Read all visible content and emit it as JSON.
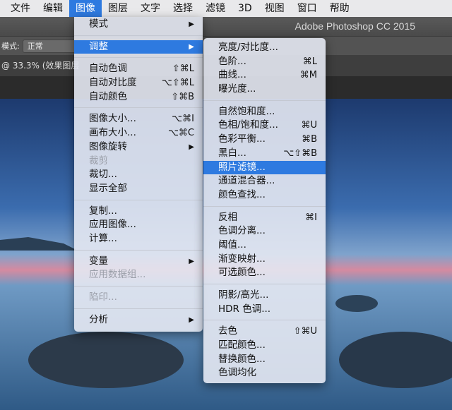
{
  "menubar": [
    "文件",
    "编辑",
    "图像",
    "图层",
    "文字",
    "选择",
    "滤镜",
    "3D",
    "视图",
    "窗口",
    "帮助"
  ],
  "active_menu_index": 2,
  "title": "Adobe Photoshop CC 2015",
  "options": {
    "mode_label": "模式:",
    "mode_value": "正常"
  },
  "doc_tab": "@ 33.3% (效果图层",
  "main_menu": [
    {
      "label": "模式",
      "submenu": true
    },
    {
      "sep": true
    },
    {
      "label": "调整",
      "submenu": true,
      "highlighted": true
    },
    {
      "sep": true
    },
    {
      "label": "自动色调",
      "shortcut": "⇧⌘L"
    },
    {
      "label": "自动对比度",
      "shortcut": "⌥⇧⌘L"
    },
    {
      "label": "自动颜色",
      "shortcut": "⇧⌘B"
    },
    {
      "sep": true
    },
    {
      "label": "图像大小...",
      "shortcut": "⌥⌘I"
    },
    {
      "label": "画布大小...",
      "shortcut": "⌥⌘C"
    },
    {
      "label": "图像旋转",
      "submenu": true
    },
    {
      "label": "裁剪",
      "disabled": true
    },
    {
      "label": "裁切..."
    },
    {
      "label": "显示全部"
    },
    {
      "sep": true
    },
    {
      "label": "复制..."
    },
    {
      "label": "应用图像..."
    },
    {
      "label": "计算..."
    },
    {
      "sep": true
    },
    {
      "label": "变量",
      "submenu": true
    },
    {
      "label": "应用数据组...",
      "disabled": true
    },
    {
      "sep": true
    },
    {
      "label": "陷印...",
      "disabled": true
    },
    {
      "sep": true
    },
    {
      "label": "分析",
      "submenu": true
    }
  ],
  "sub_menu": [
    {
      "label": "亮度/对比度..."
    },
    {
      "label": "色阶...",
      "shortcut": "⌘L"
    },
    {
      "label": "曲线...",
      "shortcut": "⌘M"
    },
    {
      "label": "曝光度..."
    },
    {
      "sep": true
    },
    {
      "label": "自然饱和度..."
    },
    {
      "label": "色相/饱和度...",
      "shortcut": "⌘U"
    },
    {
      "label": "色彩平衡...",
      "shortcut": "⌘B"
    },
    {
      "label": "黑白...",
      "shortcut": "⌥⇧⌘B"
    },
    {
      "label": "照片滤镜...",
      "highlighted": true
    },
    {
      "label": "通道混合器..."
    },
    {
      "label": "颜色查找..."
    },
    {
      "sep": true
    },
    {
      "label": "反相",
      "shortcut": "⌘I"
    },
    {
      "label": "色调分离..."
    },
    {
      "label": "阈值..."
    },
    {
      "label": "渐变映射..."
    },
    {
      "label": "可选颜色..."
    },
    {
      "sep": true
    },
    {
      "label": "阴影/高光..."
    },
    {
      "label": "HDR 色调..."
    },
    {
      "sep": true
    },
    {
      "label": "去色",
      "shortcut": "⇧⌘U"
    },
    {
      "label": "匹配颜色..."
    },
    {
      "label": "替换颜色..."
    },
    {
      "label": "色调均化"
    }
  ],
  "submenu_arrow": "▶",
  "colors": {
    "highlight": "#2e7ae0",
    "menubar": "#e9e9eb"
  }
}
